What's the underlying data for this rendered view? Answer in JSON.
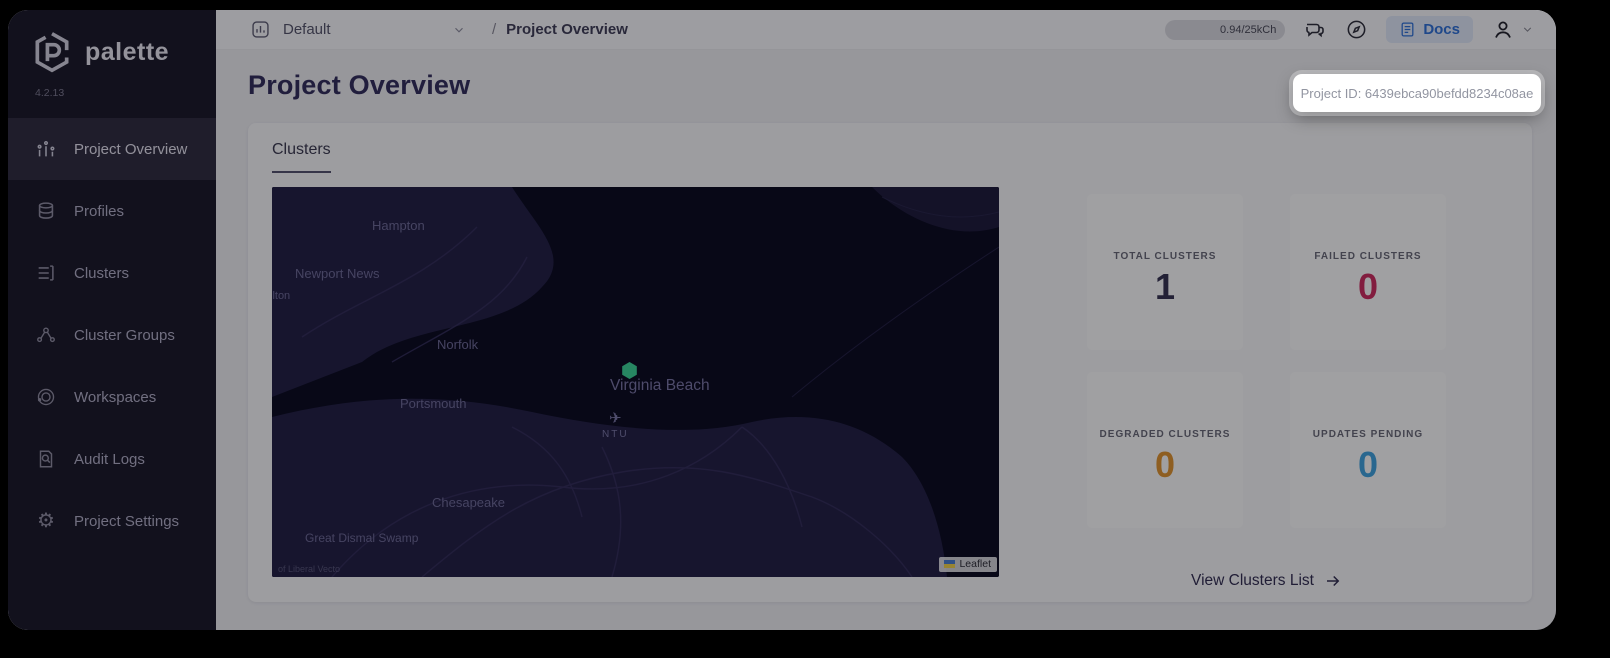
{
  "app": {
    "name": "palette",
    "version": "4.2.13"
  },
  "topbar": {
    "project_selector": {
      "label": "Default"
    },
    "breadcrumb": {
      "separator": "/",
      "label": "Project Overview"
    },
    "usage": {
      "text": "0.94/25kCh"
    },
    "docs": {
      "label": "Docs"
    }
  },
  "tooltip": {
    "text": "Project ID: 6439ebca90befdd8234c08ae"
  },
  "sidebar": {
    "items": [
      {
        "label": "Project Overview"
      },
      {
        "label": "Profiles"
      },
      {
        "label": "Clusters"
      },
      {
        "label": "Cluster Groups"
      },
      {
        "label": "Workspaces"
      },
      {
        "label": "Audit Logs"
      },
      {
        "label": "Project Settings"
      }
    ]
  },
  "page": {
    "title": "Project Overview"
  },
  "clusters_card": {
    "tab": "Clusters",
    "map": {
      "marker_color": "#3dd598",
      "city_labels": [
        "Hampton",
        "Newport News",
        "llton",
        "Norfolk",
        "Virginia Beach",
        "Portsmouth",
        "Chesapeake",
        "Great Dismal Swamp"
      ],
      "airport_code": "NTU",
      "airplane_glyph": "✈",
      "leaflet_label": "Leaflet",
      "attribution_left": "of Liberal Vecto"
    },
    "stats": [
      {
        "label": "TOTAL CLUSTERS",
        "value": "1",
        "color": "#363252"
      },
      {
        "label": "FAILED CLUSTERS",
        "value": "0",
        "color": "#cf2d60"
      },
      {
        "label": "DEGRADED CLUSTERS",
        "value": "0",
        "color": "#e2952f"
      },
      {
        "label": "UPDATES PENDING",
        "value": "0",
        "color": "#3fa3e0"
      }
    ],
    "view_link": {
      "label": "View Clusters List"
    }
  }
}
